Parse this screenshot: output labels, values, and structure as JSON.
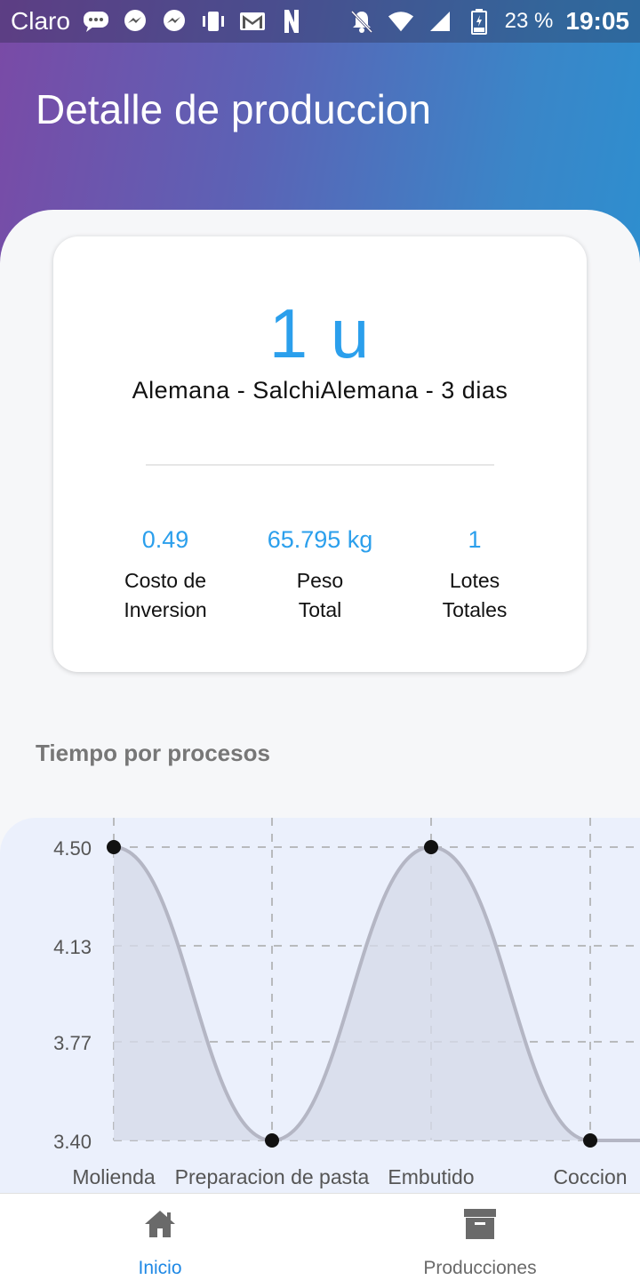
{
  "status_bar": {
    "carrier": "Claro",
    "battery": "23 %",
    "time": "19:05",
    "left_icons": [
      "chat-bubble-icon",
      "messenger-icon",
      "messenger-icon",
      "vibrate-icon",
      "gmail-icon",
      "netflix-icon"
    ],
    "right_icons": [
      "mute-icon",
      "wifi-icon",
      "signal-icon",
      "battery-icon"
    ]
  },
  "header": {
    "title": "Detalle de produccion"
  },
  "summary": {
    "quantity": "1 u",
    "product": "Alemana - SalchiAlemana - 3 dias",
    "stats": [
      {
        "value": "0.49",
        "label_line1": "Costo de",
        "label_line2": "Inversion"
      },
      {
        "value": "65.795 kg",
        "label_line1": "Peso",
        "label_line2": "Total"
      },
      {
        "value": "1",
        "label_line1": "Lotes",
        "label_line2": "Totales"
      }
    ]
  },
  "section": {
    "title": "Tiempo por procesos"
  },
  "chart_data": {
    "type": "line",
    "categories": [
      "Molienda",
      "Preparacion de pasta",
      "Embutido",
      "Coccion"
    ],
    "values": [
      4.5,
      3.4,
      4.5,
      3.4
    ],
    "y_ticks": [
      "4.50",
      "4.13",
      "3.77",
      "3.40"
    ],
    "ylim": [
      3.4,
      4.5
    ],
    "grid": true,
    "area_fill": true,
    "smooth": true,
    "colors": {
      "line": "#b4b6c4",
      "fill": "#d6dbe8",
      "point": "#111111",
      "grid": "#a8a8a8"
    }
  },
  "bottom_nav": {
    "items": [
      {
        "label": "Inicio",
        "icon": "home-icon",
        "active": true
      },
      {
        "label": "Producciones",
        "icon": "archive-box-icon",
        "active": false
      }
    ]
  },
  "colors": {
    "accent": "#2b9fec",
    "nav_active": "#1e88e5",
    "gradient_start": "#7a4aa6",
    "gradient_end": "#2e8ecf"
  }
}
